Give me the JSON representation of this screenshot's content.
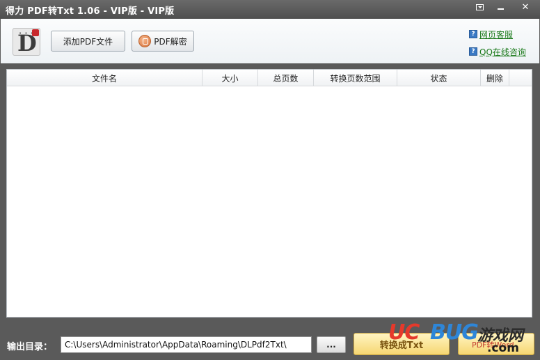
{
  "window": {
    "title": "得力 PDF转Txt 1.06 - VIP版 - VIP版",
    "controls": {
      "menu": "menu-icon",
      "minimize": "minimize-icon",
      "close": "✕"
    }
  },
  "toolbar": {
    "logo_letter": "D",
    "add_button": "添加PDF文件",
    "decrypt_button": "PDF解密"
  },
  "links": [
    {
      "icon": "?",
      "label": "网页客服"
    },
    {
      "icon": "?",
      "label": "QQ在线咨询"
    }
  ],
  "table": {
    "columns": [
      "文件名",
      "大小",
      "总页数",
      "转换页数范围",
      "状态",
      "删除"
    ],
    "rows": []
  },
  "bottom": {
    "output_label": "输出目录：",
    "output_path": "C:\\Users\\Administrator\\AppData\\Roaming\\DLPdf2Txt\\",
    "browse_button": "...",
    "convert_button": "转换成Txt"
  },
  "watermark": {
    "part1": "UC",
    "part2": "BUG",
    "chinese": "游戏网",
    "sub": "PDF转Word",
    "domain": ".com"
  }
}
